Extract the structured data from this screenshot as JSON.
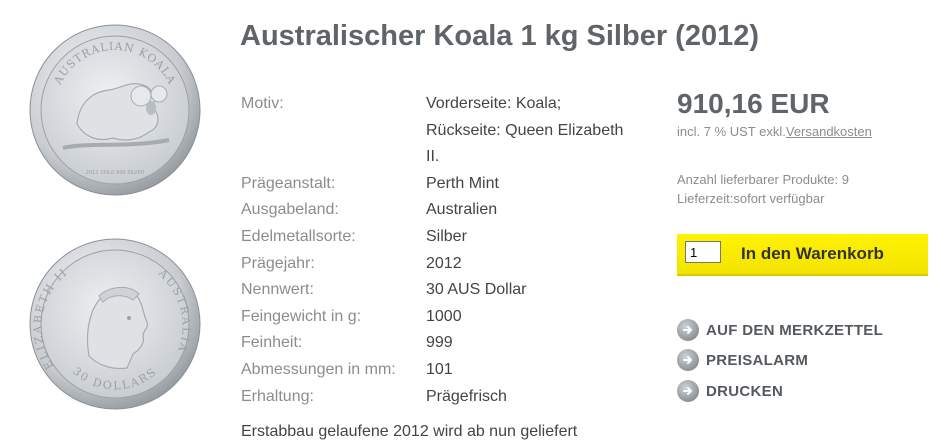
{
  "product": {
    "title": "Australischer Koala 1 kg Silber (2012)",
    "coin_front_text": "AUSTRALIAN KOALA",
    "coin_front_small": "2012 1KILO 999 SILVER",
    "coin_back_text_left": "ELIZABETH II",
    "coin_back_text_right": "AUSTRALIA",
    "coin_back_value": "30 DOLLARS"
  },
  "specs": [
    {
      "label": "Motiv:",
      "value": "Vorderseite: Koala; Rückseite: Queen Elizabeth II."
    },
    {
      "label": "Prägeanstalt:",
      "value": "Perth Mint"
    },
    {
      "label": "Ausgabeland:",
      "value": "Australien"
    },
    {
      "label": "Edelmetallsorte:",
      "value": "Silber"
    },
    {
      "label": "Prägejahr:",
      "value": "2012"
    },
    {
      "label": "Nennwert:",
      "value": "30 AUS Dollar"
    },
    {
      "label": "Feingewicht in g:",
      "value": "1000"
    },
    {
      "label": "Feinheit:",
      "value": "999"
    },
    {
      "label": "Abmessungen in mm:",
      "value": "101"
    },
    {
      "label": "Erhaltung:",
      "value": "Prägefrisch"
    }
  ],
  "more_text": "Erstabbau gelaufene 2012 wird ab nun geliefert",
  "pricing": {
    "price": "910,16 EUR",
    "tax_note": "incl. 7 % UST exkl.",
    "shipping_link": "Versandkosten",
    "stock": "Anzahl lieferbarer Produkte: 9",
    "delivery": "Lieferzeit:sofort verfügbar"
  },
  "cart": {
    "quantity": "1",
    "button_label": "In den Warenkorb"
  },
  "actions": [
    {
      "label": "AUF DEN MERKZETTEL",
      "icon": "arrow-right-circle-icon"
    },
    {
      "label": "PREISALARM",
      "icon": "arrow-right-circle-icon"
    },
    {
      "label": "DRUCKEN",
      "icon": "arrow-right-circle-icon"
    }
  ]
}
